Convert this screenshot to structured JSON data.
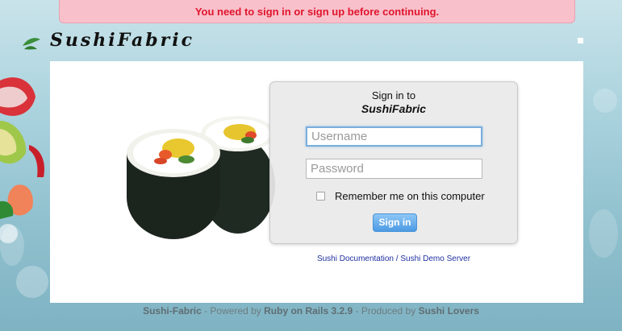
{
  "flash": {
    "message": "You need to sign in or sign up before continuing."
  },
  "brand": {
    "name": "SushiFabric"
  },
  "login": {
    "title_line1": "Sign in to",
    "title_line2": "SushiFabric",
    "username_placeholder": "Username",
    "password_placeholder": "Password",
    "remember_label": "Remember me on this computer",
    "submit_label": "Sign in"
  },
  "links": {
    "documentation": "Sushi Documentation",
    "separator": " / ",
    "demo_server": "Sushi Demo Server"
  },
  "footer": {
    "app": "Sushi-Fabric",
    "powered_by": " - Powered by ",
    "framework": "Ruby on Rails 3.2.9",
    "produced_by": " - Produced by ",
    "producer": "Sushi Lovers"
  },
  "colors": {
    "flash_bg": "#f8c0cb",
    "flash_text": "#e0152d",
    "button_blue": "#4b9be3",
    "link_blue": "#1e2fa0"
  }
}
